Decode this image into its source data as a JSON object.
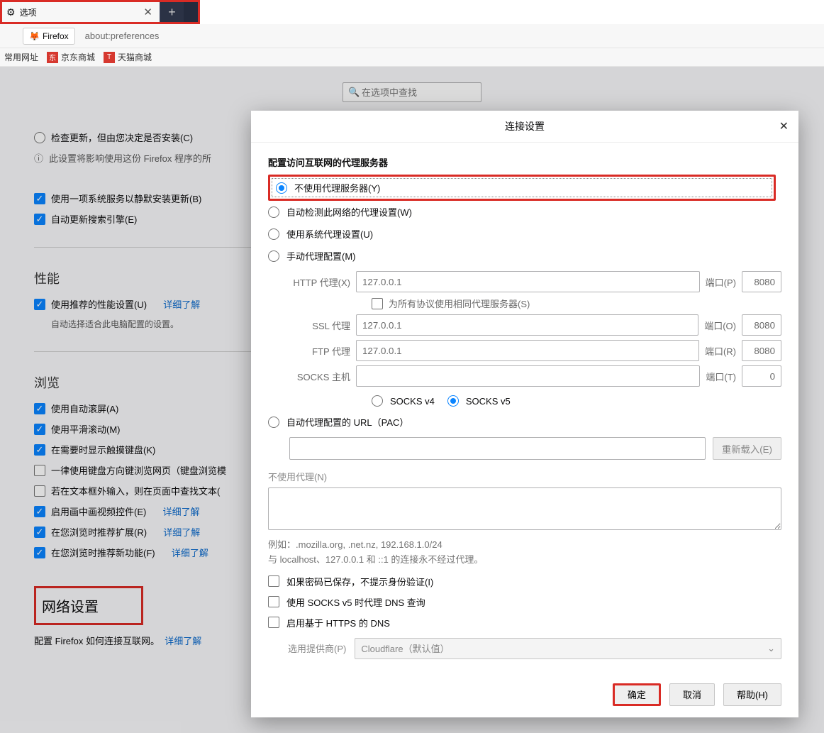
{
  "chrome": {
    "tab_title": "选项",
    "identity_label": "Firefox",
    "url": "about:preferences",
    "bookmarks": {
      "b0": "常用网址",
      "b1": "京东商城",
      "b2": "天猫商城"
    },
    "search_placeholder": "在选项中查找"
  },
  "bg": {
    "update_check": "检查更新，但由您决定是否安装(C)",
    "update_note": "此设置将影响使用这份 Firefox 程序的所",
    "silent_update": "使用一项系统服务以静默安装更新(B)",
    "auto_engine": "自动更新搜索引擎(E)",
    "perf_h": "性能",
    "perf_rec": "使用推荐的性能设置(U)",
    "perf_more": "详细了解",
    "perf_sub": "自动选择适合此电脑配置的设置。",
    "browse_h": "浏览",
    "autoscroll": "使用自动滚屏(A)",
    "smooth": "使用平滑滚动(M)",
    "touchkb": "在需要时显示触摸键盘(K)",
    "caret": "一律使用键盘方向键浏览网页（键盘浏览模",
    "findtype": "若在文本框外输入，则在页面中查找文本(",
    "pip": "启用画中画视频控件(E)",
    "pip_more": "详细了解",
    "rec_ext": "在您浏览时推荐扩展(R)",
    "rec_ext_more": "详细了解",
    "rec_feat": "在您浏览时推荐新功能(F)",
    "rec_feat_more": "详细了解",
    "net_h": "网络设置",
    "net_sub": "配置 Firefox 如何连接互联网。",
    "net_more": "详细了解"
  },
  "dialog": {
    "title": "连接设置",
    "grp": "配置访问互联网的代理服务器",
    "opt_none": "不使用代理服务器(Y)",
    "opt_auto": "自动检测此网络的代理设置(W)",
    "opt_sys": "使用系统代理设置(U)",
    "opt_manual": "手动代理配置(M)",
    "http_l": "HTTP 代理(X)",
    "http_v": "127.0.0.1",
    "http_pl": "端口(P)",
    "http_p": "8080",
    "same": "为所有协议使用相同代理服务器(S)",
    "ssl_l": "SSL 代理",
    "ssl_v": "127.0.0.1",
    "ssl_pl": "端口(O)",
    "ssl_p": "8080",
    "ftp_l": "FTP 代理",
    "ftp_v": "127.0.0.1",
    "ftp_pl": "端口(R)",
    "ftp_p": "8080",
    "socks_l": "SOCKS 主机",
    "socks_v": "",
    "socks_pl": "端口(T)",
    "socks_p": "0",
    "sv4": "SOCKS v4",
    "sv5": "SOCKS v5",
    "opt_pac": "自动代理配置的 URL（PAC）",
    "reload": "重新载入(E)",
    "nop_l": "不使用代理(N)",
    "hint1": "例如：.mozilla.org, .net.nz, 192.168.1.0/24",
    "hint2": "与 localhost、127.0.0.1 和 ::1 的连接永不经过代理。",
    "chk_auth": "如果密码已保存，不提示身份验证(I)",
    "chk_socksdns": "使用 SOCKS v5 时代理 DNS 查询",
    "chk_doh": "启用基于 HTTPS 的 DNS",
    "provider_l": "选用提供商(P)",
    "provider_v": "Cloudflare（默认值）",
    "ok": "确定",
    "cancel": "取消",
    "help": "帮助(H)"
  }
}
